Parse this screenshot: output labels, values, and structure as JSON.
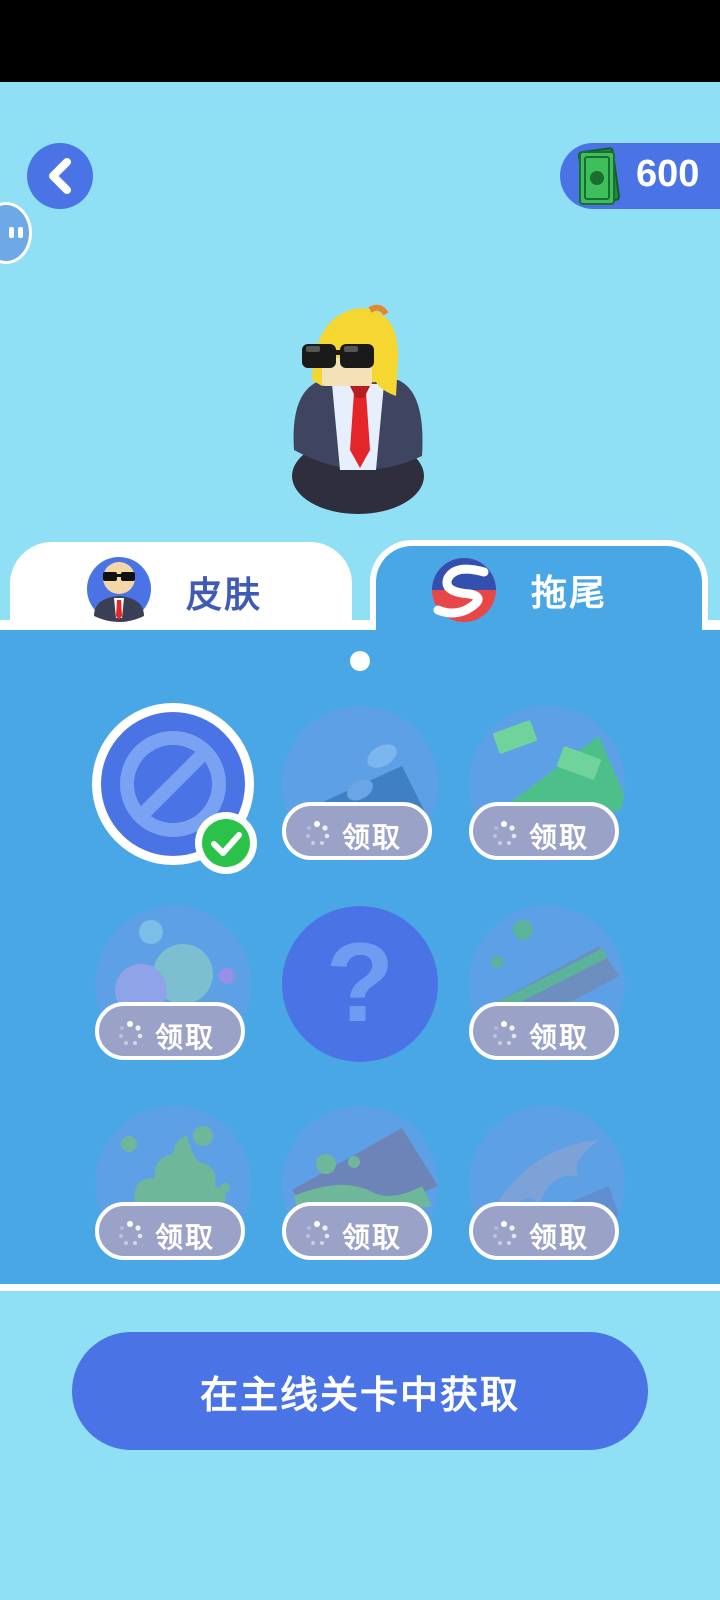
{
  "currency": {
    "amount": "600"
  },
  "tabs": [
    {
      "label": "皮肤",
      "active": false
    },
    {
      "label": "拖尾",
      "active": true
    }
  ],
  "grid": {
    "selected_index": 0,
    "claim_label": "领取",
    "items": [
      {
        "kind": "none",
        "icon": "no-trail-icon",
        "state": "selected"
      },
      {
        "kind": "footprints",
        "icon": "footprints-icon",
        "state": "claimable"
      },
      {
        "kind": "money",
        "icon": "money-trail-icon",
        "state": "claimable"
      },
      {
        "kind": "bubbles",
        "icon": "bubbles-trail-icon",
        "state": "claimable"
      },
      {
        "kind": "mystery",
        "icon": "question-mark-icon",
        "state": "locked"
      },
      {
        "kind": "ribbon",
        "icon": "ribbon-trail-icon",
        "state": "claimable"
      },
      {
        "kind": "poop",
        "icon": "poop-trail-icon",
        "state": "claimable"
      },
      {
        "kind": "slime",
        "icon": "slime-trail-icon",
        "state": "claimable"
      },
      {
        "kind": "flame",
        "icon": "flame-trail-icon",
        "state": "claimable"
      }
    ]
  },
  "cta": {
    "label": "在主线关卡中获取"
  },
  "colors": {
    "background": "#8fe0f5",
    "panel": "#4aa7e6",
    "accent": "#4a74e6",
    "badge": "#2bc24a"
  }
}
